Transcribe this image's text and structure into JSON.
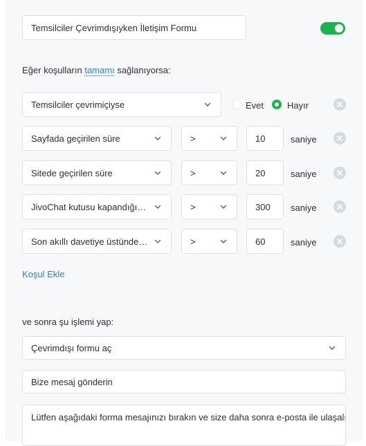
{
  "form_name": {
    "value": "Temsilciler Çevrimdışıyken İletişim Formu",
    "enabled": true,
    "accent_color": "#1ab54a"
  },
  "conditions_intro": {
    "prefix": "Eğer koşulların",
    "link": "tamamı",
    "suffix": "sağlanıyorsa:"
  },
  "condition_agents": {
    "select": "Temsilciler çevrimiçiyse",
    "option_yes": "Evet",
    "option_no": "Hayır",
    "selected": "Hayır"
  },
  "conditions": [
    {
      "field": "Sayfada geçirilen süre",
      "operator": ">",
      "value": "10",
      "unit": "saniye"
    },
    {
      "field": "Sitede geçirilen süre",
      "operator": ">",
      "value": "20",
      "unit": "saniye"
    },
    {
      "field": "JivoChat kutusu kapandığından sonra",
      "operator": ">",
      "value": "300",
      "unit": "saniye"
    },
    {
      "field": "Son akıllı davetiye üstünden geçen süre",
      "operator": ">",
      "value": "60",
      "unit": "saniye"
    }
  ],
  "add_condition_label": "Koşul Ekle",
  "action_intro": "ve sonra şu işlemi yap:",
  "action": {
    "select": "Çevrimdışı formu aç",
    "title_input": "Bize mesaj gönderin",
    "message_text": "Lütfen aşağıdaki forma mesajınızı bırakın ve size daha sonra e-posta ile ulaşalım"
  }
}
